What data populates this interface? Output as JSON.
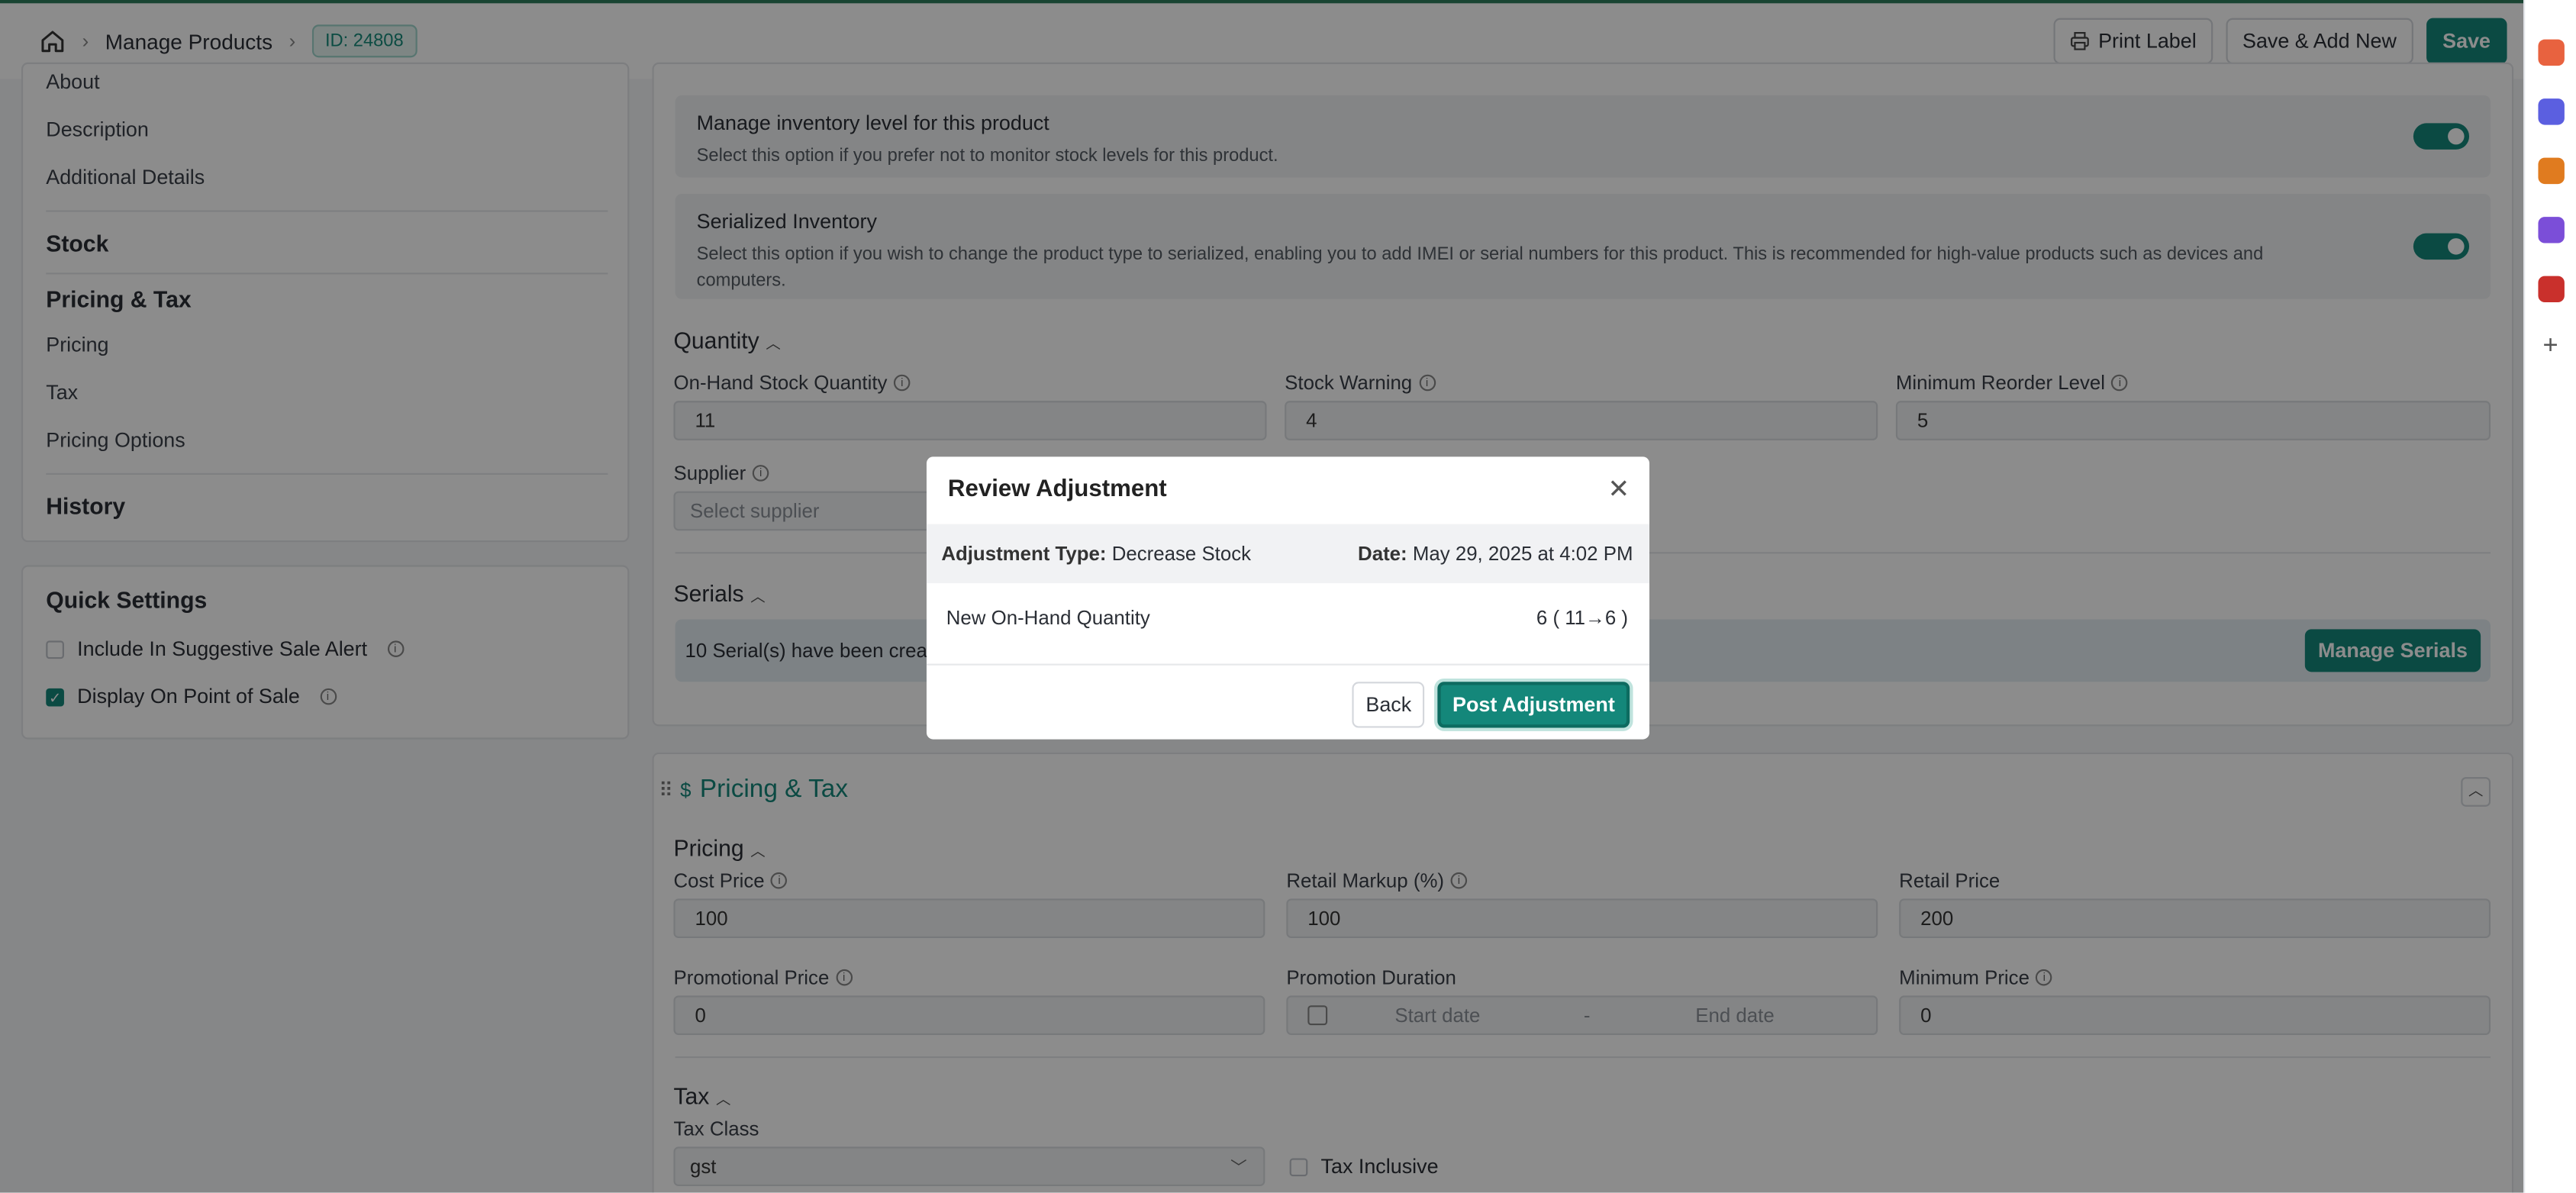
{
  "breadcrumb": {
    "items": [
      "Manage Products"
    ],
    "id_badge": "ID: 24808"
  },
  "toolbar": {
    "print_label": "Print Label",
    "save_add_new": "Save & Add New",
    "save": "Save"
  },
  "sidebar": {
    "items_top": [
      "About",
      "Description",
      "Additional Details"
    ],
    "stock": "Stock",
    "pricing_tax": "Pricing & Tax",
    "pricing_items": [
      "Pricing",
      "Tax",
      "Pricing Options"
    ],
    "history": "History"
  },
  "quick_settings": {
    "title": "Quick Settings",
    "options": [
      {
        "label": "Include In Suggestive Sale Alert",
        "checked": false
      },
      {
        "label": "Display On Point of Sale",
        "checked": true
      }
    ]
  },
  "inventory": {
    "manage": {
      "title": "Manage inventory level for this product",
      "desc": "Select this option if you prefer not to monitor stock levels for this product."
    },
    "serialized": {
      "title": "Serialized Inventory",
      "desc": "Select this option if you wish to change the product type to serialized, enabling you to add IMEI or serial numbers for this product. This is recommended for high-value products such as devices and computers."
    }
  },
  "quantity": {
    "title": "Quantity",
    "on_hand_label": "On-Hand Stock Quantity",
    "on_hand_value": "11",
    "warning_label": "Stock Warning",
    "warning_value": "4",
    "reorder_label": "Minimum Reorder Level",
    "reorder_value": "5",
    "supplier_label": "Supplier",
    "supplier_placeholder": "Select supplier"
  },
  "serials": {
    "title": "Serials",
    "text": "10 Serial(s) have been crea",
    "manage_button": "Manage Serials"
  },
  "pricing_section": {
    "title": "Pricing & Tax",
    "pricing_title": "Pricing",
    "cost_label": "Cost Price",
    "cost_value": "100",
    "markup_label": "Retail Markup (%)",
    "markup_value": "100",
    "retail_label": "Retail Price",
    "retail_value": "200",
    "promo_label": "Promotional Price",
    "promo_value": "0",
    "duration_label": "Promotion Duration",
    "start_placeholder": "Start date",
    "dash": "-",
    "end_placeholder": "End date",
    "min_label": "Minimum Price",
    "min_value": "0",
    "tax_title": "Tax",
    "tax_class_label": "Tax Class",
    "tax_class_value": "gst",
    "tax_inclusive": "Tax Inclusive"
  },
  "modal": {
    "title": "Review Adjustment",
    "type_label": "Adjustment Type:",
    "type_value": "Decrease Stock",
    "date_label": "Date:",
    "date_value": "May 29, 2025 at 4:02 PM",
    "new_qty_label": "New On-Hand Quantity",
    "new_qty_value": "6 ( 11→6 )",
    "back": "Back",
    "post": "Post Adjustment"
  }
}
